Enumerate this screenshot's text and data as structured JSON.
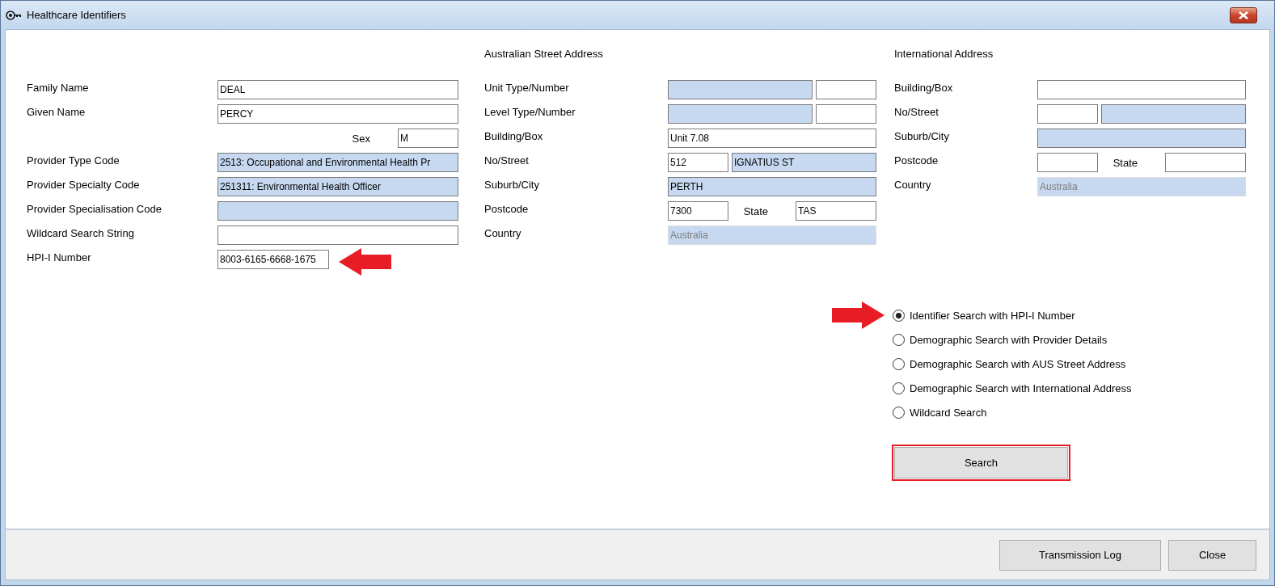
{
  "window": {
    "title": "Healthcare Identifiers"
  },
  "columns": [
    {
      "rows": [
        {
          "label": "Family Name",
          "fields": [
            {
              "value": "DEAL",
              "kind": "full",
              "shaded": false
            }
          ]
        },
        {
          "label": "Given Name",
          "fields": [
            {
              "value": "PERCY",
              "kind": "full",
              "shaded": false
            }
          ]
        },
        {
          "fields": [
            {
              "label": "Sex",
              "value": "M",
              "kind": "narrow",
              "shaded": false
            }
          ]
        },
        {
          "label": "Provider Type Code",
          "fields": [
            {
              "value": "2513: Occupational and Environmental Health Pr",
              "kind": "full",
              "shaded": true
            }
          ]
        },
        {
          "label": "Provider Specialty Code",
          "fields": [
            {
              "value": "251311: Environmental Health Officer",
              "kind": "full",
              "shaded": true
            }
          ]
        },
        {
          "label": "Provider Specialisation Code",
          "fields": [
            {
              "kind": "full",
              "shaded": true
            }
          ]
        },
        {
          "label": "Wildcard Search String",
          "fields": [
            {
              "kind": "full",
              "shaded": false
            }
          ]
        },
        {
          "label": "HPI-I Number",
          "fields": [
            {
              "value": "8003-6165-6668-1675",
              "kind": "half",
              "shaded": false,
              "pointed": true
            }
          ]
        }
      ]
    },
    {
      "heading": "Australian Street Address",
      "rows": [
        {
          "label": "Unit Type/Number",
          "fields": [
            {
              "kind": "full",
              "shaded": true
            },
            {
              "kind": "narrow",
              "shaded": false
            }
          ]
        },
        {
          "label": "Level Type/Number",
          "fields": [
            {
              "kind": "full",
              "shaded": true
            },
            {
              "kind": "narrow",
              "shaded": false
            }
          ]
        },
        {
          "label": "Building/Box",
          "fields": [
            {
              "value": "Unit 7.08",
              "kind": "full",
              "shaded": false
            }
          ]
        },
        {
          "label": "No/Street",
          "fields": [
            {
              "value": "512",
              "kind": "narrow",
              "shaded": false
            },
            {
              "value": "IGNATIUS ST",
              "kind": "full",
              "shaded": true
            }
          ]
        },
        {
          "label": "Suburb/City",
          "fields": [
            {
              "value": "PERTH",
              "kind": "full",
              "shaded": true
            }
          ]
        },
        {
          "label": "Postcode",
          "fields": [
            {
              "value": "7300",
              "kind": "narrow",
              "shaded": false
            },
            {
              "label": "State",
              "value": "TAS",
              "kind": "medium",
              "shaded": false
            }
          ]
        },
        {
          "label": "Country",
          "fields": [
            {
              "value": "Australia",
              "kind": "full",
              "shaded": true,
              "disabled": true
            }
          ]
        }
      ]
    },
    {
      "heading": "International Address",
      "rows": [
        {
          "label": "Building/Box",
          "fields": [
            {
              "kind": "full",
              "shaded": false
            }
          ]
        },
        {
          "label": "No/Street",
          "fields": [
            {
              "kind": "narrow",
              "shaded": false
            },
            {
              "kind": "full",
              "shaded": true
            }
          ]
        },
        {
          "label": "Suburb/City",
          "fields": [
            {
              "kind": "full",
              "shaded": true
            }
          ]
        },
        {
          "label": "Postcode",
          "fields": [
            {
              "kind": "narrow",
              "shaded": false
            },
            {
              "label": "State",
              "kind": "medium",
              "shaded": false
            }
          ]
        },
        {
          "label": "Country",
          "fields": [
            {
              "value": "Australia",
              "kind": "full",
              "shaded": true,
              "disabled": true
            }
          ]
        }
      ]
    }
  ],
  "search_options": [
    {
      "label": "Identifier Search with HPI-I Number",
      "selected": true,
      "pointed": true
    },
    {
      "label": "Demographic Search with Provider Details",
      "selected": false
    },
    {
      "label": "Demographic Search with AUS Street Address",
      "selected": false
    },
    {
      "label": "Demographic Search with International Address",
      "selected": false
    },
    {
      "label": "Wildcard Search",
      "selected": false
    }
  ],
  "search_button": {
    "label": "Search",
    "highlighted": true
  },
  "footer_buttons": [
    {
      "label": "Transmission Log"
    },
    {
      "label": "Close"
    }
  ]
}
